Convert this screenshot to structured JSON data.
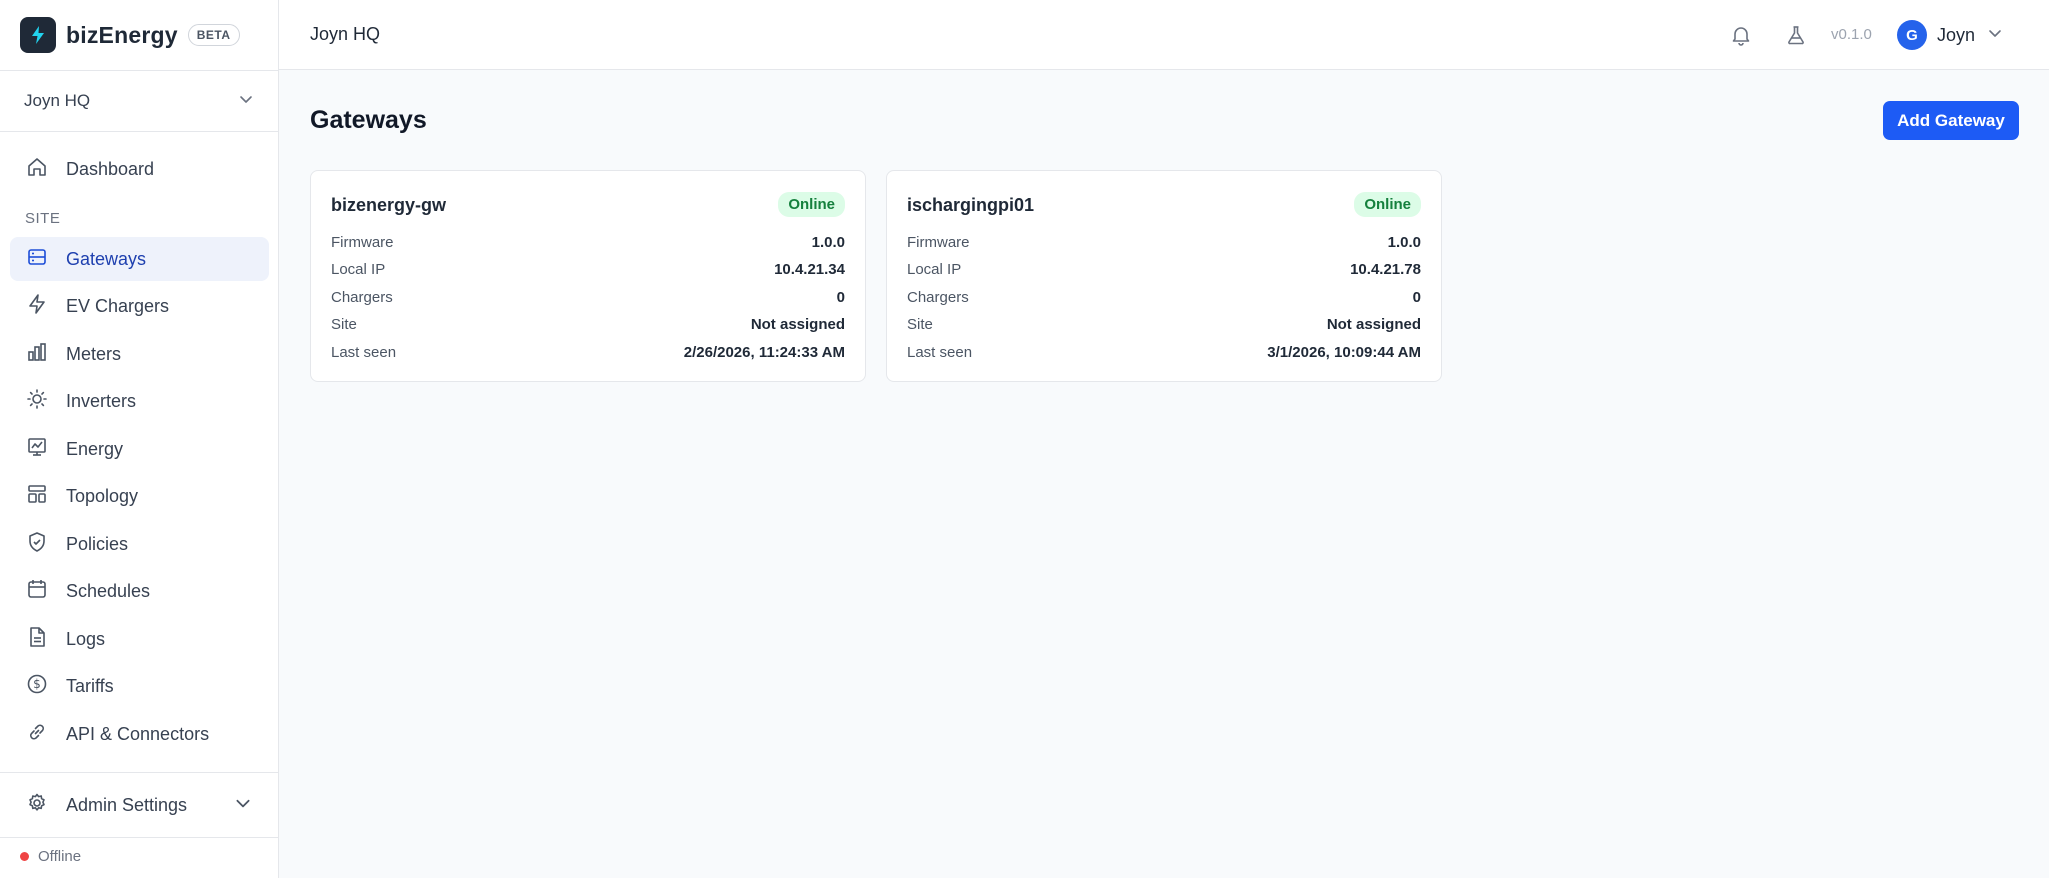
{
  "brand": {
    "name": "bizEnergy",
    "badge": "BETA"
  },
  "site_selector": {
    "value": "Joyn HQ"
  },
  "nav": {
    "dashboard": "Dashboard",
    "section_site": "SITE",
    "items": [
      {
        "label": "Gateways",
        "icon": "server-icon",
        "active": true
      },
      {
        "label": "EV Chargers",
        "icon": "bolt-icon"
      },
      {
        "label": "Meters",
        "icon": "bar-chart-icon"
      },
      {
        "label": "Inverters",
        "icon": "sun-icon"
      },
      {
        "label": "Energy",
        "icon": "line-chart-icon"
      },
      {
        "label": "Topology",
        "icon": "topology-icon"
      },
      {
        "label": "Policies",
        "icon": "shield-icon"
      },
      {
        "label": "Schedules",
        "icon": "calendar-icon"
      },
      {
        "label": "Logs",
        "icon": "file-icon"
      },
      {
        "label": "Tariffs",
        "icon": "dollar-icon"
      },
      {
        "label": "API & Connectors",
        "icon": "link-icon"
      }
    ],
    "admin": "Admin Settings"
  },
  "connection_status": "Offline",
  "header": {
    "breadcrumb": "Joyn HQ",
    "version": "v0.1.0",
    "user_initial": "G",
    "user_name": "Joyn"
  },
  "page": {
    "title": "Gateways",
    "add_button": "Add Gateway"
  },
  "field_labels": {
    "firmware": "Firmware",
    "local_ip": "Local IP",
    "chargers": "Chargers",
    "site": "Site",
    "last_seen": "Last seen"
  },
  "gateways": [
    {
      "name": "bizenergy-gw",
      "status": "Online",
      "firmware": "1.0.0",
      "local_ip": "10.4.21.34",
      "chargers": "0",
      "site": "Not assigned",
      "last_seen": "2/26/2026, 11:24:33 AM"
    },
    {
      "name": "ischargingpi01",
      "status": "Online",
      "firmware": "1.0.0",
      "local_ip": "10.4.21.78",
      "chargers": "0",
      "site": "Not assigned",
      "last_seen": "3/1/2026, 10:09:44 AM"
    }
  ],
  "colors": {
    "accent": "#1d5bf5",
    "online_bg": "#dcfce7",
    "online_text": "#15803d",
    "offline_dot": "#ef4444"
  }
}
